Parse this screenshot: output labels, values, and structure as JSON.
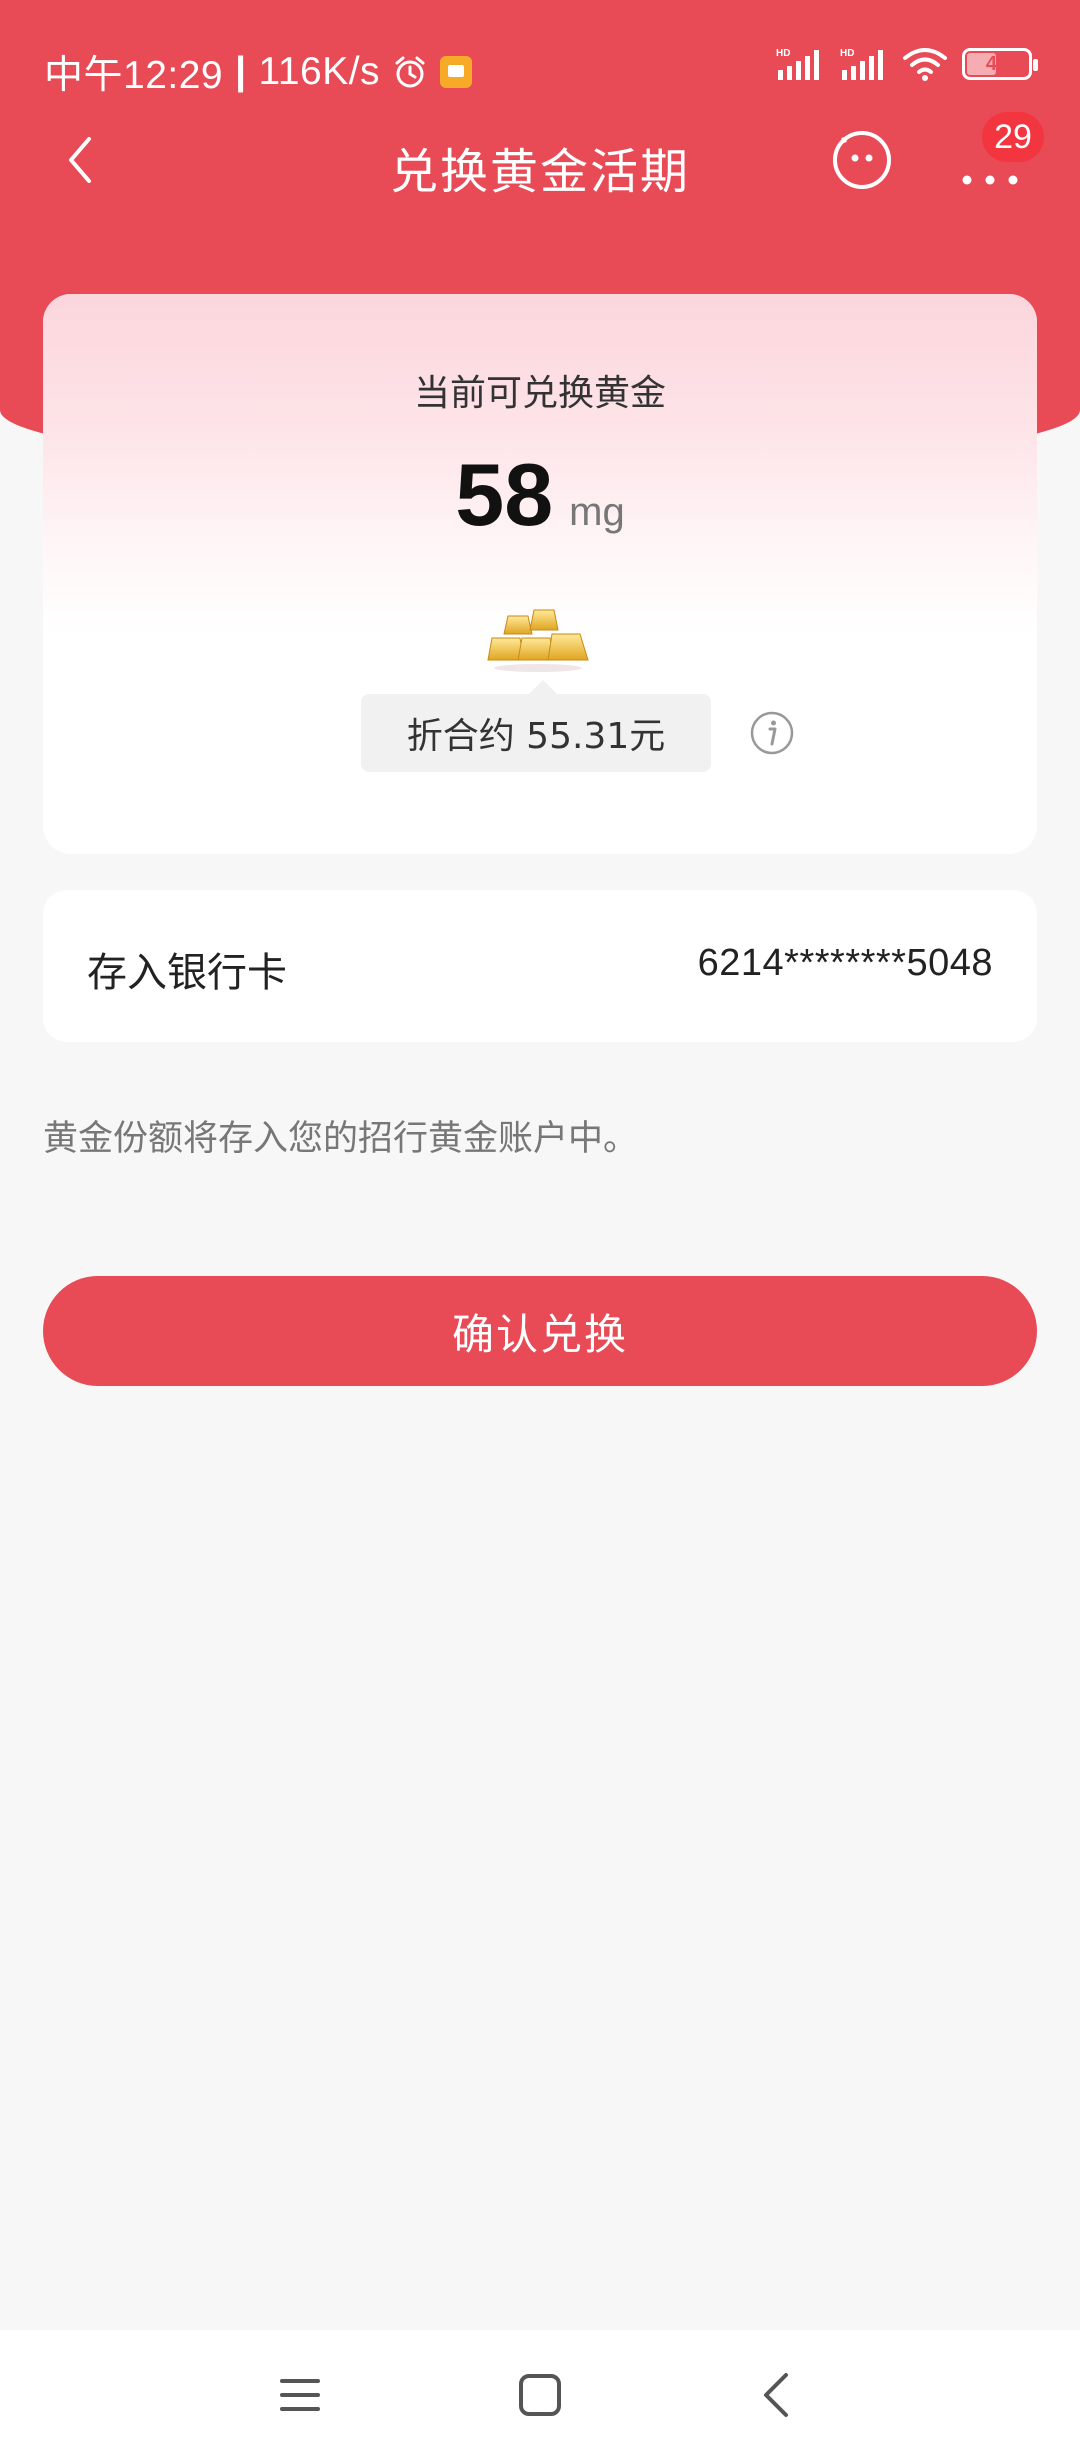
{
  "status_bar": {
    "time": "中午12:29",
    "net_speed": "116K/s",
    "battery_level": "41",
    "icons": [
      "alarm-icon",
      "app-notification-icon",
      "hd-signal-icon",
      "hd-signal-icon",
      "wifi-icon",
      "battery-icon"
    ]
  },
  "nav": {
    "title": "兑换黄金活期",
    "back_icon": "chevron-left-icon",
    "service_icon": "smiley-service-icon",
    "more_icon": "more-dots-icon",
    "badge_count": "29"
  },
  "gold_card": {
    "label": "当前可兑换黄金",
    "amount": "58",
    "unit": "mg",
    "gold_icon": "gold-bars-icon",
    "equivalent": "折合约 55.31元",
    "info_icon": "info-icon"
  },
  "bank": {
    "label": "存入银行卡",
    "card_number": "6214********5048"
  },
  "note": "黄金份额将存入您的招行黄金账户中。",
  "confirm_button": "确认兑换",
  "colors": {
    "accent": "#e84a56",
    "badge": "#f2353f",
    "background": "#f7f7f7"
  },
  "system_nav": {
    "icons": [
      "menu-icon",
      "home-icon",
      "back-icon"
    ]
  }
}
